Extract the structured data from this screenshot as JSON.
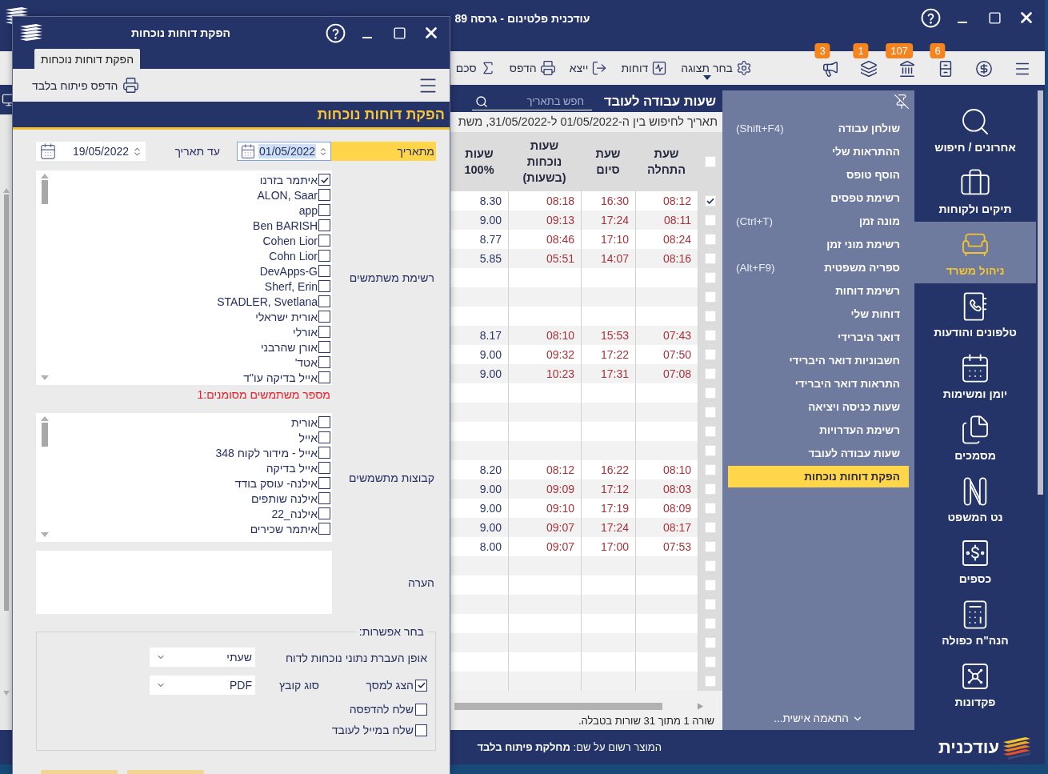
{
  "main_window": {
    "title": "עודכנית פלטינום - גרסה 89"
  },
  "toolbar": {
    "icon_buttons": [
      {
        "kind": "menu"
      },
      {
        "kind": "dollar"
      },
      {
        "kind": "cabinet",
        "badge": "6"
      },
      {
        "kind": "bank",
        "badge": "107"
      },
      {
        "kind": "layers",
        "badge": "1"
      },
      {
        "kind": "megaphone",
        "badge": "3"
      }
    ],
    "actions": [
      {
        "kind": "view",
        "label": "בחר תצוגה"
      },
      {
        "kind": "reports",
        "label": "דוחות"
      },
      {
        "kind": "export",
        "label": "ייצא"
      },
      {
        "kind": "print",
        "label": "הדפס"
      },
      {
        "kind": "sum",
        "label": "סכם"
      }
    ]
  },
  "nav": {
    "items": [
      {
        "kind": "search",
        "label": "אחרונים / חיפוש",
        "selected": false
      },
      {
        "kind": "briefcase",
        "label": "תיקים ולקוחות",
        "selected": false
      },
      {
        "kind": "chair",
        "label": "ניהול משרד",
        "selected": true
      },
      {
        "kind": "phonebook",
        "label": "טלפונים והודעות",
        "selected": false
      },
      {
        "kind": "calendar",
        "label": "יומן ומשימות",
        "selected": false
      },
      {
        "kind": "documents",
        "label": "מסמכים",
        "selected": false
      },
      {
        "kind": "pillars",
        "label": "נט המשפט",
        "selected": false
      },
      {
        "kind": "money",
        "label": "כספים",
        "selected": false
      },
      {
        "kind": "calculator",
        "label": "הנה\"ח כפולה",
        "selected": false
      },
      {
        "kind": "safe",
        "label": "פקדונות",
        "selected": false
      }
    ]
  },
  "menu": {
    "items": [
      {
        "label": "שולחן עבודה",
        "shortcut": "(Shift+F4)",
        "selected": false
      },
      {
        "label": "ההתראות שלי",
        "selected": false
      },
      {
        "label": "הוסף טופס",
        "selected": false
      },
      {
        "label": "רשימת טפסים",
        "selected": false
      },
      {
        "label": "מונה זמן",
        "shortcut": "(Ctrl+T)",
        "selected": false
      },
      {
        "label": "רשימת מוני זמן",
        "selected": false
      },
      {
        "label": "ספריה משפטית",
        "shortcut": "(Alt+F9)",
        "selected": false
      },
      {
        "label": "רשימת דוחות",
        "selected": false
      },
      {
        "label": "דוחות שלי",
        "selected": false
      },
      {
        "label": "דואר היברידי",
        "selected": false
      },
      {
        "label": "חשבוניות דואר היברידי",
        "selected": false
      },
      {
        "label": "התראות דואר היברידי",
        "selected": false
      },
      {
        "label": "שעות כניסה ויציאה",
        "selected": false
      },
      {
        "label": "רשימת העדרויות",
        "selected": false
      },
      {
        "label": "שעות עבודה לעובד",
        "selected": false
      },
      {
        "label": "הפקת דוחות נוכחות",
        "selected": true
      }
    ],
    "customize": "התאמה אישית..."
  },
  "table_panel": {
    "title": "שעות עבודה לעובד",
    "search": {
      "placeholder": "חפש בתאריך"
    },
    "subtitle": "תאריך לחיפוש בין ה-01/05/2022 ל-31/05/2022, משת",
    "header_checked": false,
    "columns": [
      {
        "label": "שעת התחלה",
        "kind": "time"
      },
      {
        "label": "שעת סיום",
        "kind": "time"
      },
      {
        "label": "שעות נוכחות (בשעות)",
        "kind": "time"
      },
      {
        "label": "שעות 100%",
        "kind": "hours"
      }
    ],
    "rows": [
      {
        "checked": true,
        "cells": [
          "08:12",
          "16:30",
          "08:18",
          "8.30"
        ]
      },
      {
        "checked": false,
        "cells": [
          "08:11",
          "17:24",
          "09:13",
          "9.00"
        ]
      },
      {
        "checked": false,
        "cells": [
          "08:24",
          "17:10",
          "08:46",
          "8.77"
        ]
      },
      {
        "checked": false,
        "cells": [
          "08:16",
          "14:07",
          "05:51",
          "5.85"
        ]
      },
      {
        "checked": false
      },
      {
        "checked": false
      },
      {
        "checked": false
      },
      {
        "checked": false,
        "cells": [
          "07:43",
          "15:53",
          "08:10",
          "8.17"
        ]
      },
      {
        "checked": false,
        "cells": [
          "07:50",
          "17:22",
          "09:32",
          "9.00"
        ]
      },
      {
        "checked": false,
        "cells": [
          "07:08",
          "17:31",
          "10:23",
          "9.00"
        ]
      },
      {
        "checked": false
      },
      {
        "checked": false
      },
      {
        "checked": false
      },
      {
        "checked": false
      },
      {
        "checked": false,
        "cells": [
          "08:10",
          "16:22",
          "08:12",
          "8.20"
        ]
      },
      {
        "checked": false,
        "cells": [
          "08:03",
          "17:12",
          "09:09",
          "9.00"
        ]
      },
      {
        "checked": false,
        "cells": [
          "08:09",
          "17:19",
          "09:10",
          "9.00"
        ]
      },
      {
        "checked": false,
        "cells": [
          "08:17",
          "17:24",
          "09:07",
          "9.00"
        ]
      },
      {
        "checked": false,
        "cells": [
          "07:53",
          "17:00",
          "09:07",
          "8.00"
        ]
      },
      {
        "checked": false
      },
      {
        "checked": false
      },
      {
        "checked": false
      },
      {
        "checked": false
      },
      {
        "checked": false
      },
      {
        "checked": false
      },
      {
        "checked": false
      }
    ],
    "status": "שורה 1 מתוך 31 שורות בטבלה."
  },
  "footer": {
    "brand": "עודכנית",
    "registration": "המוצר רשום על שם: **מחלקת פיתוח בלבד**"
  },
  "dialog": {
    "title": "הפקת דוחות נוכחות",
    "tabs": [
      {
        "label": "הפקת דוחות נוכחות",
        "selected": true
      }
    ],
    "print_button": "הדפס פיתוח בלבד",
    "heading": "הפקת דוחות נוכחות",
    "from_date": {
      "label": "מתאריך",
      "value": "01/05/2022",
      "focused": true
    },
    "to_date": {
      "label": "עד תאריך",
      "value": "19/05/2022",
      "focused": false
    },
    "users": {
      "label": "רשימת משתמשים",
      "items": [
        {
          "label": "איתמר בזרנו",
          "checked": true
        },
        {
          "label": "ALON, Saar",
          "checked": false
        },
        {
          "label": "app",
          "checked": false
        },
        {
          "label": "Ben BARISH",
          "checked": false
        },
        {
          "label": "Cohen Lior",
          "checked": false
        },
        {
          "label": "Cohn Lior",
          "checked": false
        },
        {
          "label": "DevApps-G",
          "checked": false
        },
        {
          "label": "Sherf, Erin",
          "checked": false
        },
        {
          "label": "STADLER, Svetlana",
          "checked": false
        },
        {
          "label": "אורית ישראלי",
          "checked": false
        },
        {
          "label": "אורלי",
          "checked": false
        },
        {
          "label": "אורן שהרבני",
          "checked": false
        },
        {
          "label": "אטד'",
          "checked": false
        },
        {
          "label": "אייל בדיקה עו\"ד",
          "checked": false
        }
      ],
      "count": "מספר משתמשים מסומנים:1"
    },
    "groups": {
      "label": "קבוצות מתשמשים",
      "items": [
        {
          "label": "אורית",
          "checked": false
        },
        {
          "label": "אייל",
          "checked": false
        },
        {
          "label": "אייל - מידור לקוח 348",
          "checked": false
        },
        {
          "label": "אייל בדיקה",
          "checked": false
        },
        {
          "label": "אילנה- עוסק בודד",
          "checked": false
        },
        {
          "label": "אילנה שותפים",
          "checked": false
        },
        {
          "label": "אילנה_22",
          "checked": false
        },
        {
          "label": "איתמר שכירים",
          "checked": false
        }
      ]
    },
    "note": {
      "label": "הערה"
    },
    "options": {
      "legend": "בחר אפשרות:",
      "transfer": {
        "label": "אופן העברת נתוני נוכחות לדוח",
        "value": "שעתי"
      },
      "file_type": {
        "label": "סוג קובץ",
        "value": "PDF"
      },
      "checks": [
        {
          "label": "הצג למסך",
          "checked": true
        },
        {
          "label": "שלח להדפסה",
          "checked": false
        },
        {
          "label": "שלח במייל לעובד",
          "checked": false
        }
      ]
    }
  }
}
